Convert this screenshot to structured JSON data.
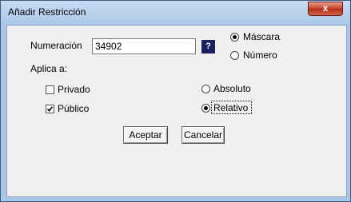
{
  "window": {
    "title": "Añadir Restricción",
    "close_glyph": "x"
  },
  "form": {
    "numeracion_label": "Numeración",
    "numeracion_value": "34902",
    "help_glyph": "?",
    "aplica_label": "Aplica a:",
    "mode_options": [
      {
        "label": "Máscara",
        "selected": true
      },
      {
        "label": "Número",
        "selected": false
      }
    ],
    "applies_to": [
      {
        "label": "Privado",
        "checked": false
      },
      {
        "label": "Público",
        "checked": true
      }
    ],
    "type_options": [
      {
        "label": "Absoluto",
        "selected": false
      },
      {
        "label": "Relativo",
        "selected": true
      }
    ]
  },
  "buttons": {
    "accept_label": "Aceptar",
    "cancel_label": "Cancelar"
  }
}
